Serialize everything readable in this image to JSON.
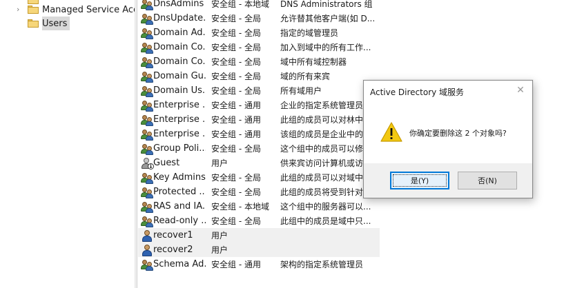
{
  "tree": {
    "items": [
      {
        "label": "Managed Service Acco",
        "expander": "›"
      },
      {
        "label": "Users",
        "selected": true
      }
    ]
  },
  "list": {
    "rows": [
      {
        "name": "DnsAdmins",
        "type": "安全组 - 本地域",
        "desc": "DNS Administrators 组",
        "icon": "group-icon"
      },
      {
        "name": "DnsUpdate...",
        "type": "安全组 - 全局",
        "desc": "允许替其他客户端(如 D...",
        "icon": "group-icon"
      },
      {
        "name": "Domain Ad...",
        "type": "安全组 - 全局",
        "desc": "指定的域管理员",
        "icon": "group-icon"
      },
      {
        "name": "Domain Co...",
        "type": "安全组 - 全局",
        "desc": "加入到域中的所有工作...",
        "icon": "group-icon"
      },
      {
        "name": "Domain Co...",
        "type": "安全组 - 全局",
        "desc": "域中所有域控制器",
        "icon": "group-icon"
      },
      {
        "name": "Domain Gu...",
        "type": "安全组 - 全局",
        "desc": "域的所有来宾",
        "icon": "group-icon"
      },
      {
        "name": "Domain Us...",
        "type": "安全组 - 全局",
        "desc": "所有域用户",
        "icon": "group-icon"
      },
      {
        "name": "Enterprise ...",
        "type": "安全组 - 通用",
        "desc": "企业的指定系统管理员",
        "icon": "group-icon"
      },
      {
        "name": "Enterprise ...",
        "type": "安全组 - 通用",
        "desc": "此组的成员可以对林中",
        "icon": "group-icon"
      },
      {
        "name": "Enterprise ...",
        "type": "安全组 - 通用",
        "desc": "该组的成员是企业中的",
        "icon": "group-icon"
      },
      {
        "name": "Group Poli...",
        "type": "安全组 - 全局",
        "desc": "这个组中的成员可以修",
        "icon": "group-icon"
      },
      {
        "name": "Guest",
        "type": "用户",
        "desc": "供来宾访问计算机或访",
        "icon": "disabled-user-icon"
      },
      {
        "name": "Key Admins",
        "type": "安全组 - 全局",
        "desc": "此组的成员可以对域中",
        "icon": "group-icon"
      },
      {
        "name": "Protected ...",
        "type": "安全组 - 全局",
        "desc": "此组的成员将受到针对",
        "icon": "group-icon"
      },
      {
        "name": "RAS and IA...",
        "type": "安全组 - 本地域",
        "desc": "这个组中的服务器可以...",
        "icon": "group-icon"
      },
      {
        "name": "Read-only ...",
        "type": "安全组 - 全局",
        "desc": "此组中的成员是域中只...",
        "icon": "group-icon"
      },
      {
        "name": "recover1",
        "type": "用户",
        "desc": "",
        "icon": "user-icon",
        "highlighted": true
      },
      {
        "name": "recover2",
        "type": "用户",
        "desc": "",
        "icon": "user-icon",
        "highlighted": true
      },
      {
        "name": "Schema Ad...",
        "type": "安全组 - 通用",
        "desc": "架构的指定系统管理员",
        "icon": "group-icon"
      }
    ]
  },
  "dialog": {
    "title": "Active Directory 域服务",
    "close_glyph": "✕",
    "message": "你确定要删除这 2 个对象吗?",
    "yes_label": "是(Y)",
    "no_label": "否(N)",
    "icon": "warning-icon"
  },
  "colors": {
    "accent": "#0078d7",
    "highlight_row": "#f0f0f0",
    "selected_tree": "#d9d9d9",
    "warning": "#f2c811"
  }
}
